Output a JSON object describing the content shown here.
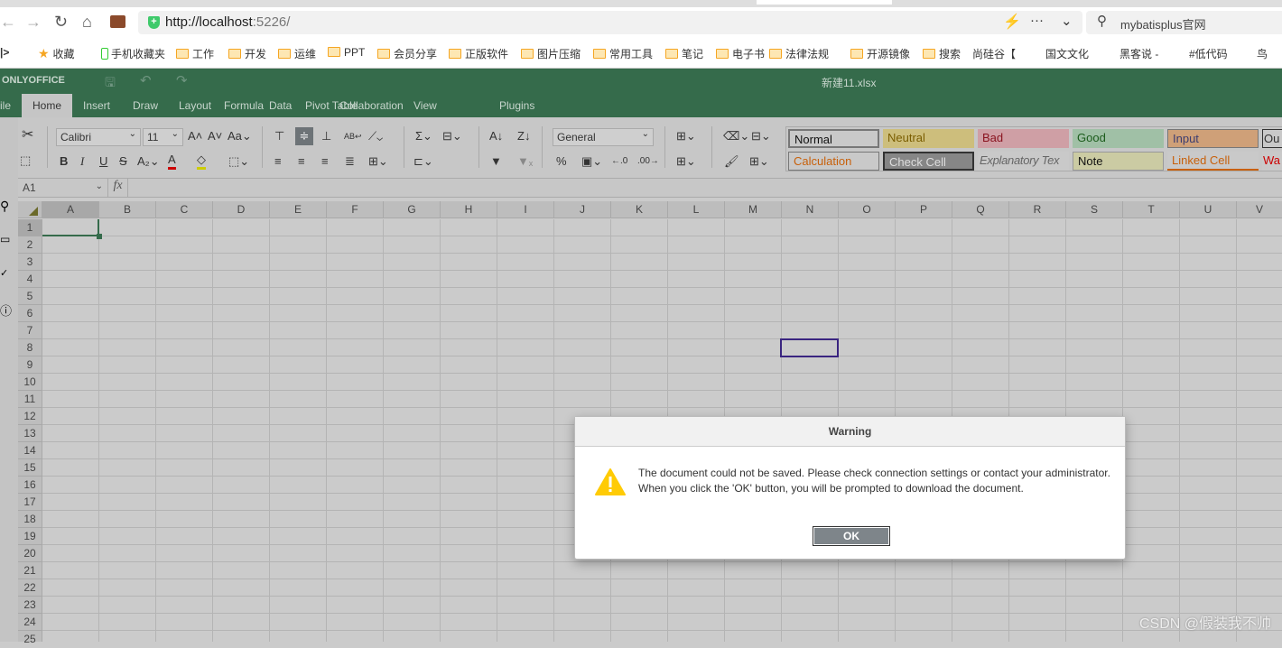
{
  "browser": {
    "url_host": "http://localhost",
    "url_rest": ":5226/",
    "search_text": "mybatisplus官网",
    "bookmarks": [
      "收藏",
      "手机收藏夹",
      "工作",
      "开发",
      "运维",
      "PPT",
      "会员分享",
      "正版软件",
      "图片压缩",
      "常用工具",
      "笔记",
      "电子书",
      "法律法规",
      "开源镜像",
      "搜索",
      "尚硅谷【",
      "国文文化",
      "黑客说 -",
      "#低代码",
      "鸟"
    ]
  },
  "app": {
    "brand": "ONLYOFFICE",
    "doc_title": "新建11.xlsx",
    "accent": "#356b4b",
    "tabs": [
      "ile",
      "Home",
      "Insert",
      "Draw",
      "Layout",
      "Formula",
      "Data",
      "Pivot Table",
      "Collaboration",
      "View",
      "Plugins"
    ],
    "active_tab": "Home"
  },
  "toolbar": {
    "font_name": "Calibri",
    "font_size": "11",
    "number_format": "General",
    "styles_row1": [
      "Normal",
      "Neutral",
      "Bad",
      "Good",
      "Input",
      "Ou"
    ],
    "styles_row2": [
      "Calculation",
      "Check Cell",
      "Explanatory Tex",
      "Note",
      "Linked Cell",
      "Wa"
    ]
  },
  "formula_bar": {
    "cell_ref": "A1",
    "fx": "fx"
  },
  "sheet": {
    "columns": [
      "A",
      "B",
      "C",
      "D",
      "E",
      "F",
      "G",
      "H",
      "I",
      "J",
      "K",
      "L",
      "M",
      "N",
      "O",
      "P",
      "Q",
      "R",
      "S",
      "T",
      "U",
      "V"
    ],
    "rows": [
      "1",
      "2",
      "3",
      "4",
      "5",
      "6",
      "7",
      "8",
      "9",
      "10",
      "11",
      "12",
      "13",
      "14",
      "15",
      "16",
      "17",
      "18",
      "19",
      "20",
      "21",
      "22",
      "23",
      "24",
      "25"
    ],
    "active_cell": "A1",
    "highlighted_cell": "N8"
  },
  "dialog": {
    "title": "Warning",
    "line1": "The document could not be saved. Please check connection settings or contact your administrator.",
    "line2": "When you click the 'OK' button, you will be prompted to download the document.",
    "ok": "OK",
    "icon": "warning-triangle-icon"
  },
  "watermark": "CSDN @假装我不帅"
}
